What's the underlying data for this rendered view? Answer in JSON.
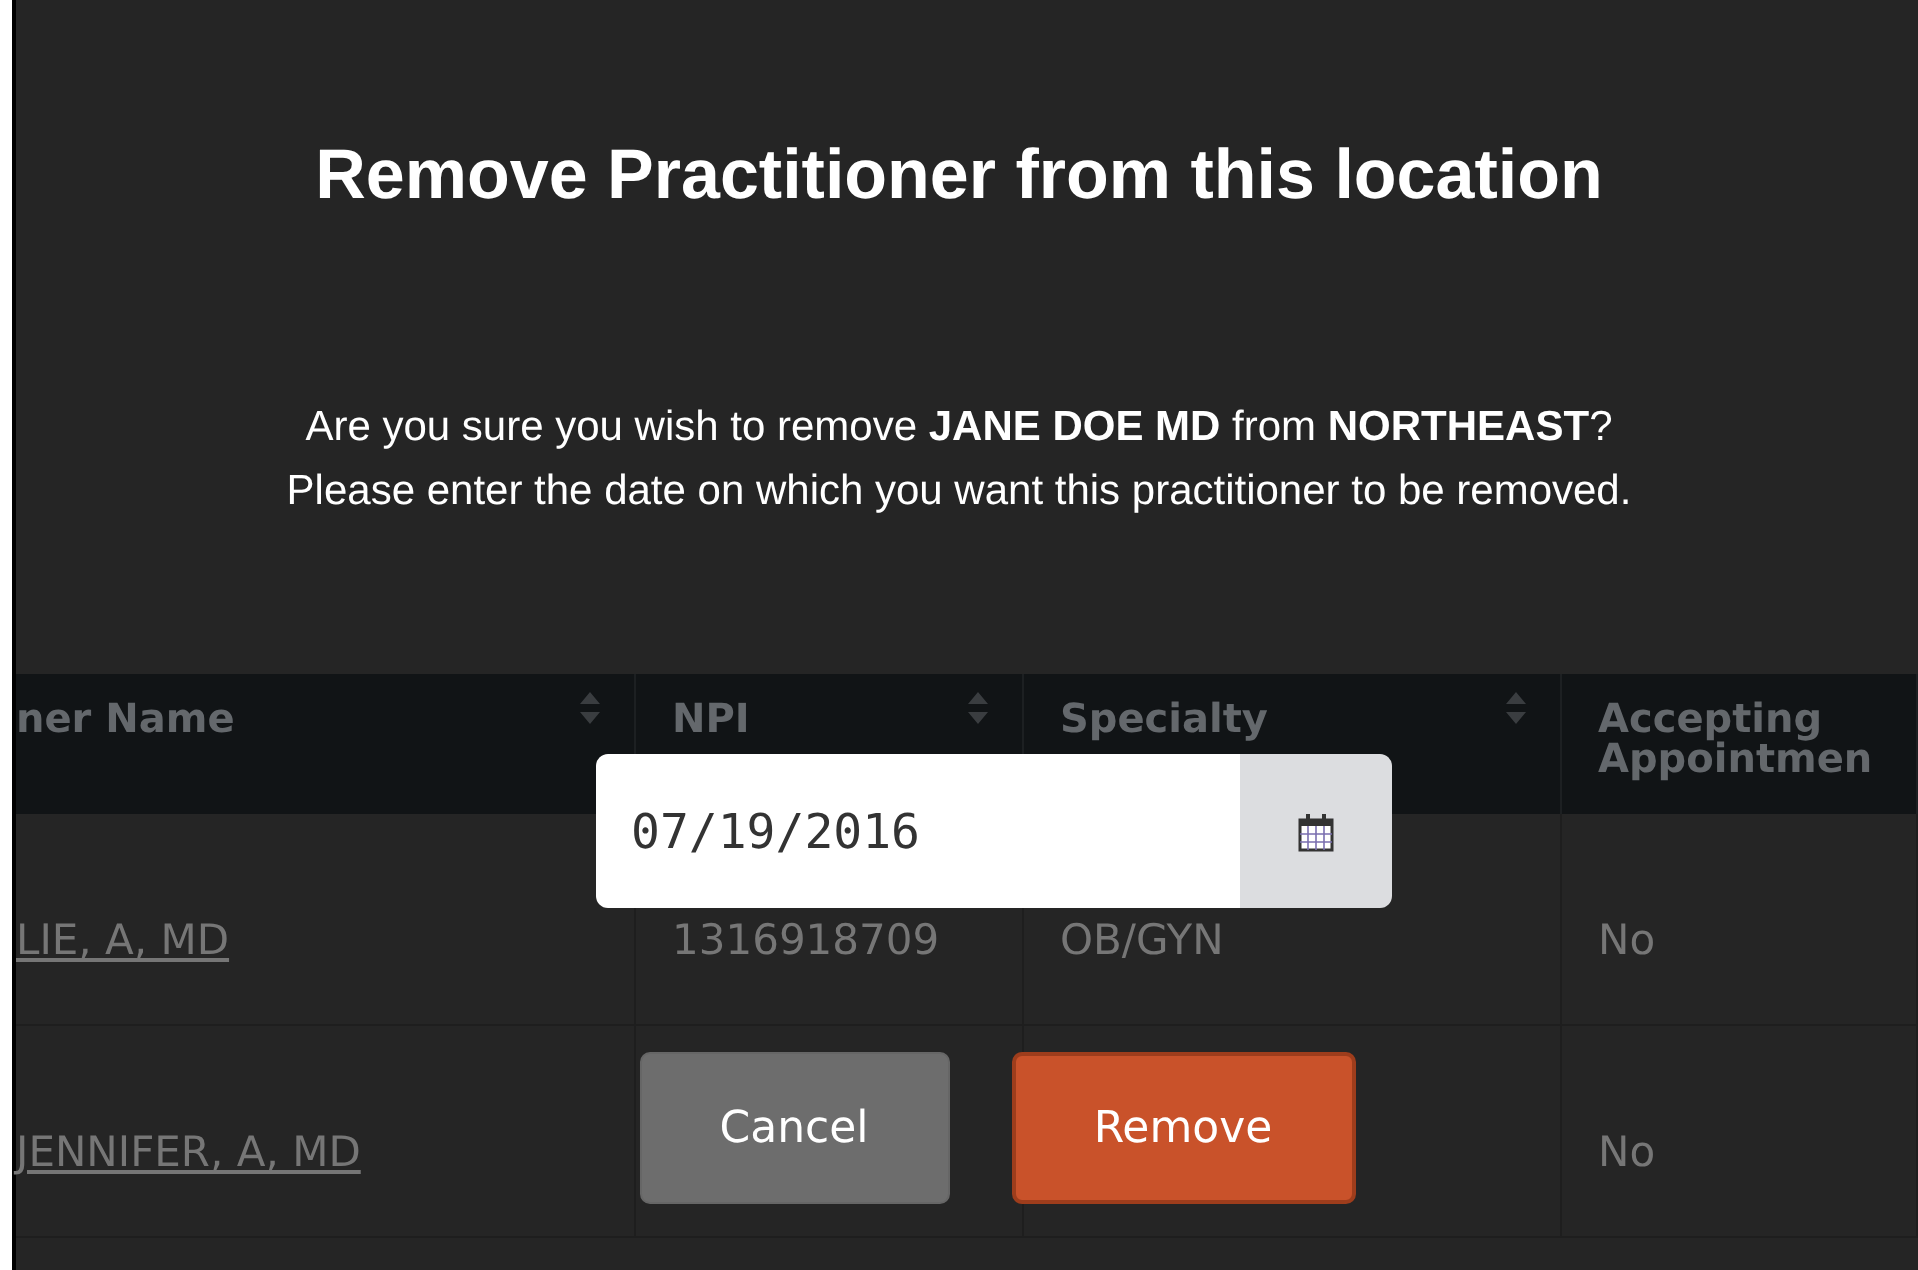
{
  "background_page": {
    "table": {
      "columns": [
        "ner Name",
        "NPI",
        "Specialty",
        "Accepting Appointmen"
      ],
      "rows": [
        [
          "LIE, A, MD",
          "1316918709",
          "OB/GYN",
          "No"
        ],
        [
          "JENNIFER, A, MD",
          "",
          "",
          "No"
        ]
      ]
    }
  },
  "dialog": {
    "title": "Remove Practitioner from this location",
    "message": [
      "Are you sure you wish to remove **JANE DOE MD** from **NORTHEAST**?",
      "Please enter the date on which you want this practitioner to be removed."
    ],
    "date_field": {
      "value": "07/19/2016"
    },
    "buttons": [
      {
        "label": "Cancel",
        "kind": "secondary"
      },
      {
        "label": "Remove",
        "kind": "danger"
      }
    ]
  }
}
